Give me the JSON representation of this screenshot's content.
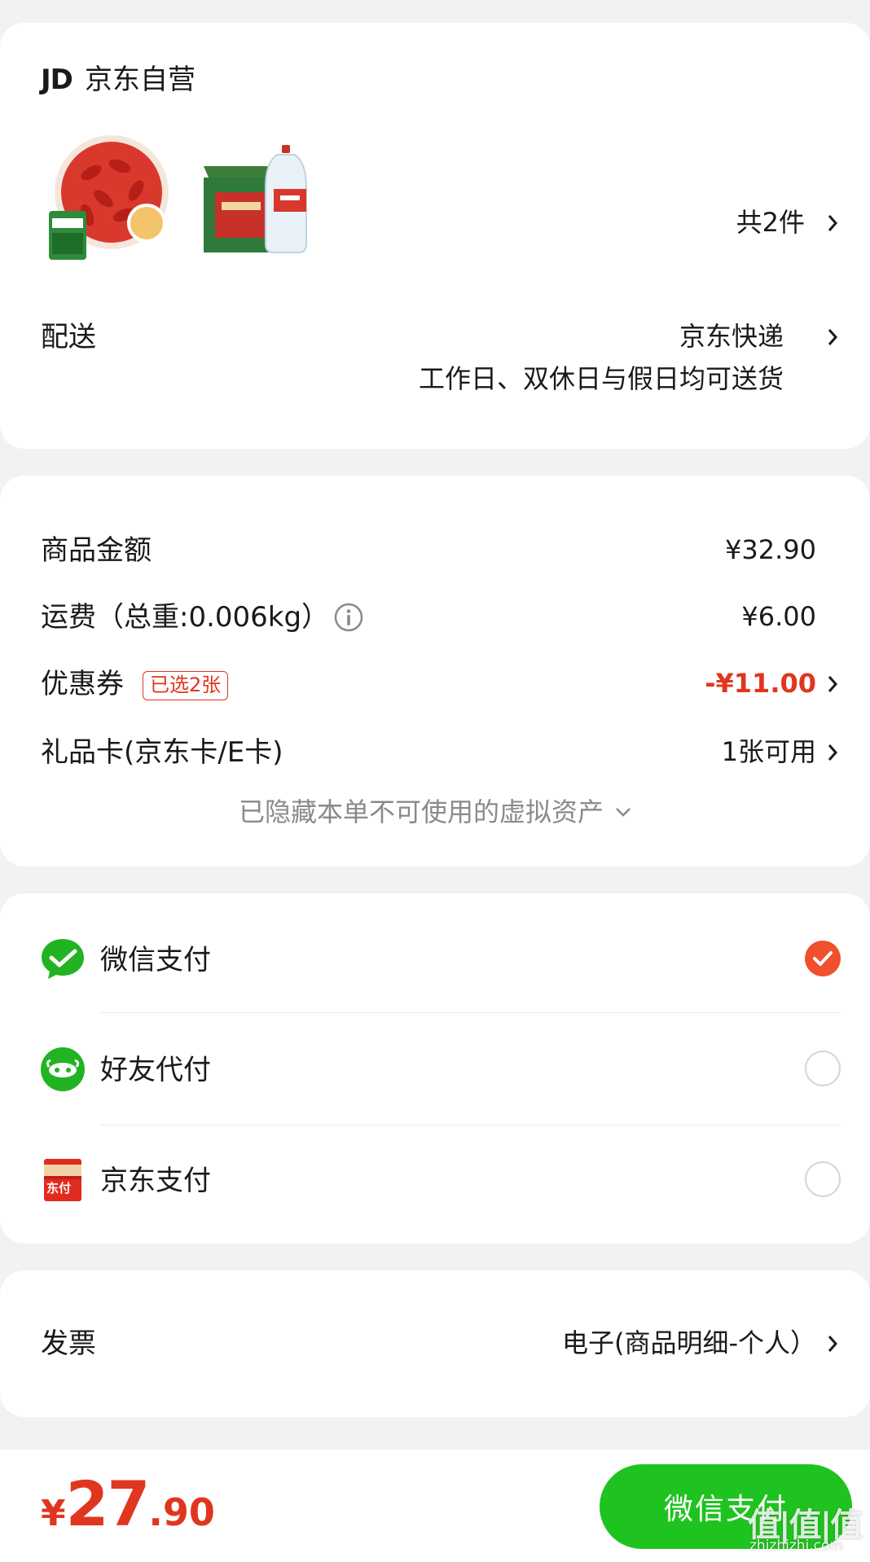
{
  "shop": {
    "logo_text": "JD",
    "name": "京东自营",
    "item_count": "共2件",
    "shipping_label": "配送",
    "shipping_method": "京东快递",
    "shipping_note": "工作日、双休日与假日均可送货"
  },
  "summary": {
    "goods_label": "商品金额",
    "goods_value": "¥32.90",
    "freight_label": "运费（总重:0.006kg）",
    "freight_value": "¥6.00",
    "coupon_label": "优惠券",
    "coupon_badge": "已选2张",
    "coupon_value": "-¥11.00",
    "giftcard_label": "礼品卡(京东卡/E卡)",
    "giftcard_value": "1张可用",
    "hidden_assets": "已隐藏本单不可使用的虚拟资产"
  },
  "payment": {
    "options": [
      {
        "label": "微信支付",
        "selected": true
      },
      {
        "label": "好友代付",
        "selected": false
      },
      {
        "label": "京东支付",
        "selected": false,
        "icon_text": "东付"
      }
    ]
  },
  "invoice": {
    "label": "发票",
    "value": "电子(商品明细-个人）"
  },
  "bottom": {
    "currency": "¥",
    "total_int": "27",
    "total_dec": ".90",
    "pay_button": "微信支付",
    "watermark": "值|值|值",
    "watermark_sub": "zhizhizhi.com"
  },
  "colors": {
    "accent_red": "#e0361f",
    "wechat_green": "#1fc31f",
    "radio_checked": "#f0502e"
  }
}
